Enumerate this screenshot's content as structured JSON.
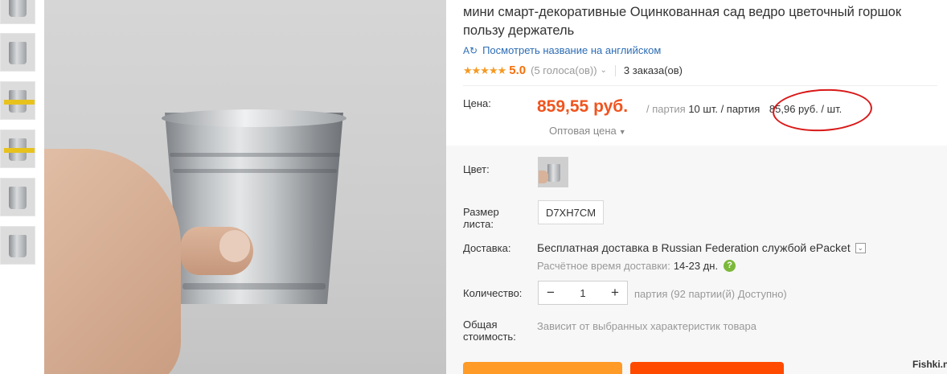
{
  "product": {
    "title": "мини смарт-декоративные Оцинкованная сад ведро цветочный горшок пользу держатель",
    "translate_label": "Посмотреть название на английском",
    "rating_score": "5.0",
    "votes": "(5 голоса(ов))",
    "orders": "3 заказа(ов)"
  },
  "price": {
    "label": "Цена:",
    "value": "859,55 руб.",
    "unit_pre": "/ партия",
    "lot": "10 шт. / партия",
    "per_piece": "85,96 руб. / шт.",
    "wholesale": "Оптовая цена"
  },
  "options": {
    "color_label": "Цвет:",
    "size_label": "Размер листа:",
    "size_value": "D7XH7CM",
    "shipping_label": "Доставка:",
    "shipping_text": "Бесплатная доставка в Russian Federation службой ePacket",
    "eta_label": "Расчётное время доставки:",
    "eta_days": "14-23 дн.",
    "quantity_label": "Количество:",
    "quantity": "1",
    "qty_minus": "−",
    "qty_plus": "+",
    "available": "партия (92 партии(й) Доступно)",
    "total_label": "Общая стоимость:",
    "total_text": "Зависит от выбранных характеристик товара"
  },
  "watermark": "Fishki.net",
  "colors": {
    "price": "#f0541e",
    "link": "#2d6db5",
    "star": "#f59a23",
    "circle": "#d91818"
  }
}
